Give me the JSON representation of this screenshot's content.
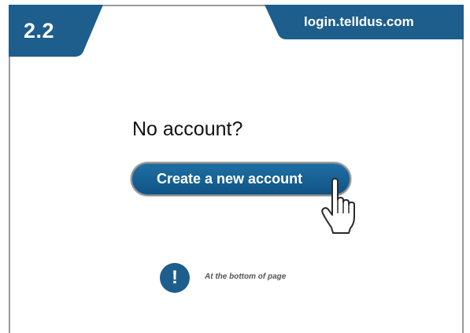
{
  "header": {
    "step": "2.2",
    "url": "login.telldus.com"
  },
  "main": {
    "heading": "No account?",
    "create_button_label": "Create a new account"
  },
  "note": {
    "icon_glyph": "!",
    "text": "At the bottom of page"
  },
  "colors": {
    "brand_blue": "#1d5e8c",
    "frame_gray": "#9a9a9a"
  },
  "icons": {
    "cursor": "hand-pointer-icon",
    "note": "exclamation-icon"
  }
}
